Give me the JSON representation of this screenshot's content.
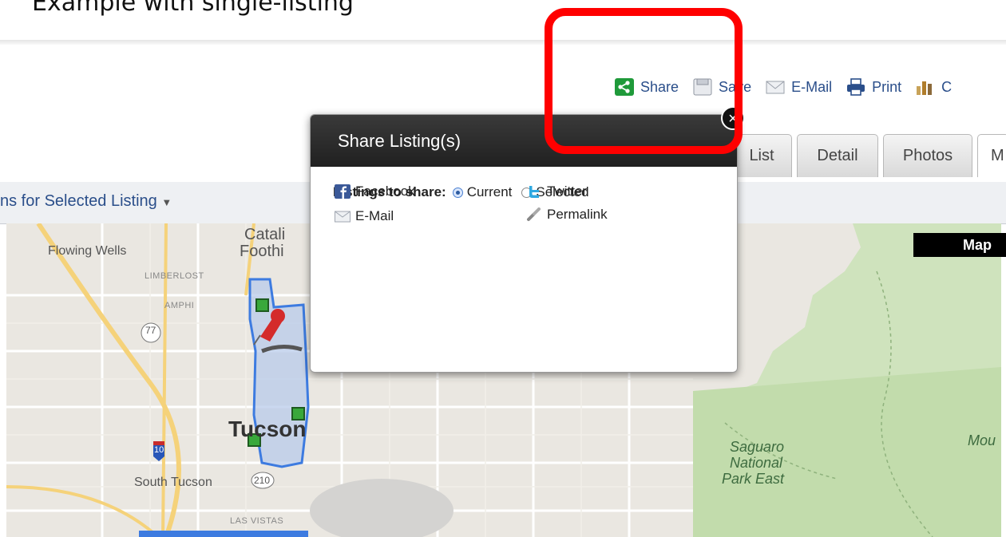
{
  "caption": "Example with single-listing",
  "toolbar": {
    "share": "Share",
    "save": "Save",
    "email": "E-Mail",
    "print": "Print",
    "compare_partial": "C"
  },
  "tabs": {
    "list": "List",
    "detail": "Detail",
    "photos": "Photos",
    "map_partial": "M"
  },
  "actions_label": "ns for Selected Listing",
  "map": {
    "toggle": "Map",
    "labels": {
      "flowing_wells": "Flowing Wells",
      "catalina_1": "Catali",
      "catalina_2": "Foothi",
      "limberlost": "LIMBERLOST",
      "amphi": "AMPHI",
      "route77": "77",
      "tucson": "Tucson",
      "route10": "10",
      "south_tucson": "South Tucson",
      "route210": "210",
      "las_vistas": "LAS VISTAS",
      "park_1": "Saguaro",
      "park_2": "National",
      "park_3": "Park East",
      "mou": "Mou"
    }
  },
  "dialog": {
    "title": "Share Listing(s)",
    "listings_label": "Listings to share:",
    "radio_current": "Current",
    "radio_selected": "Selected",
    "facebook": "Facebook",
    "twitter": "Twitter",
    "email": "E-Mail",
    "permalink": "Permalink",
    "close": "×"
  },
  "colors": {
    "highlight": "#ff0000",
    "link": "#2a4e8a",
    "dialog_header": "#2a2a2a",
    "share_green": "#1f9a3a"
  }
}
